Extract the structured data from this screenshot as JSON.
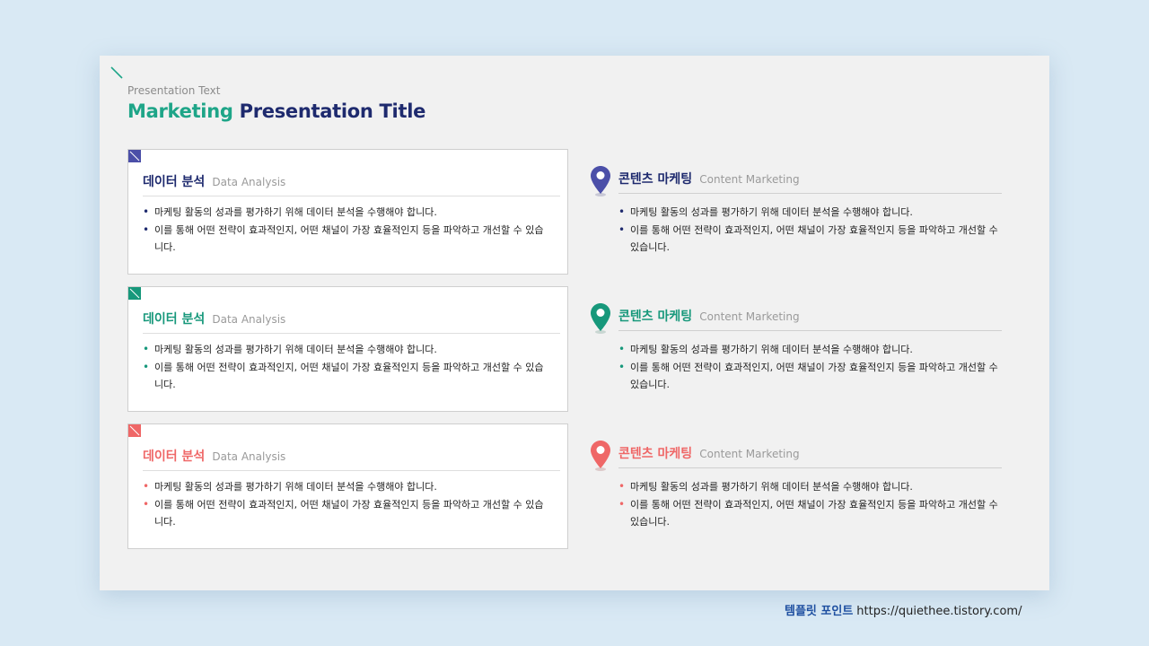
{
  "header": {
    "subtitle": "Presentation Text",
    "title_part1": "Marketing",
    "title_part2": "Presentation Title"
  },
  "colors": {
    "navy": "#1e2a6e",
    "teal": "#17987b",
    "coral": "#ef6767",
    "indigo": "#4b4fa8"
  },
  "cards": [
    {
      "title_ko": "데이터 분석",
      "title_en": "Data Analysis",
      "bullets": [
        "마케팅 활동의 성과를 평가하기 위해 데이터 분석을 수행해야 합니다.",
        "이를 통해 어떤 전략이 효과적인지, 어떤 채널이 가장 효율적인지 등을 파악하고 개선할 수 있습니다."
      ]
    },
    {
      "title_ko": "데이터 분석",
      "title_en": "Data Analysis",
      "bullets": [
        "마케팅 활동의 성과를 평가하기 위해 데이터 분석을 수행해야 합니다.",
        "이를 통해 어떤 전략이 효과적인지, 어떤 채널이 가장 효율적인지 등을 파악하고 개선할 수 있습니다."
      ]
    },
    {
      "title_ko": "데이터 분석",
      "title_en": "Data Analysis",
      "bullets": [
        "마케팅 활동의 성과를 평가하기 위해 데이터 분석을 수행해야 합니다.",
        "이를 통해 어떤 전략이 효과적인지, 어떤 채널이 가장 효율적인지 등을 파악하고 개선할 수 있습니다."
      ]
    }
  ],
  "items": [
    {
      "title_ko": "콘텐츠 마케팅",
      "title_en": "Content Marketing",
      "icon": "map-pin-icon",
      "bullets": [
        "마케팅 활동의 성과를 평가하기 위해 데이터 분석을 수행해야 합니다.",
        "이를 통해 어떤 전략이 효과적인지, 어떤 채널이 가장 효율적인지 등을 파악하고 개선할 수 있습니다."
      ]
    },
    {
      "title_ko": "콘텐츠 마케팅",
      "title_en": "Content Marketing",
      "icon": "map-pin-icon",
      "bullets": [
        "마케팅 활동의 성과를 평가하기 위해 데이터 분석을 수행해야 합니다.",
        "이를 통해 어떤 전략이 효과적인지, 어떤 채널이 가장 효율적인지 등을 파악하고 개선할 수 있습니다."
      ]
    },
    {
      "title_ko": "콘텐츠 마케팅",
      "title_en": "Content Marketing",
      "icon": "map-pin-icon",
      "bullets": [
        "마케팅 활동의 성과를 평가하기 위해 데이터 분석을 수행해야 합니다.",
        "이를 통해 어떤 전략이 효과적인지, 어떤 채널이 가장 효율적인지 등을 파악하고 개선할 수 있습니다."
      ]
    }
  ],
  "footer": {
    "brand": "템플릿 포인트",
    "url": "https://quiethee.tistory.com/"
  }
}
